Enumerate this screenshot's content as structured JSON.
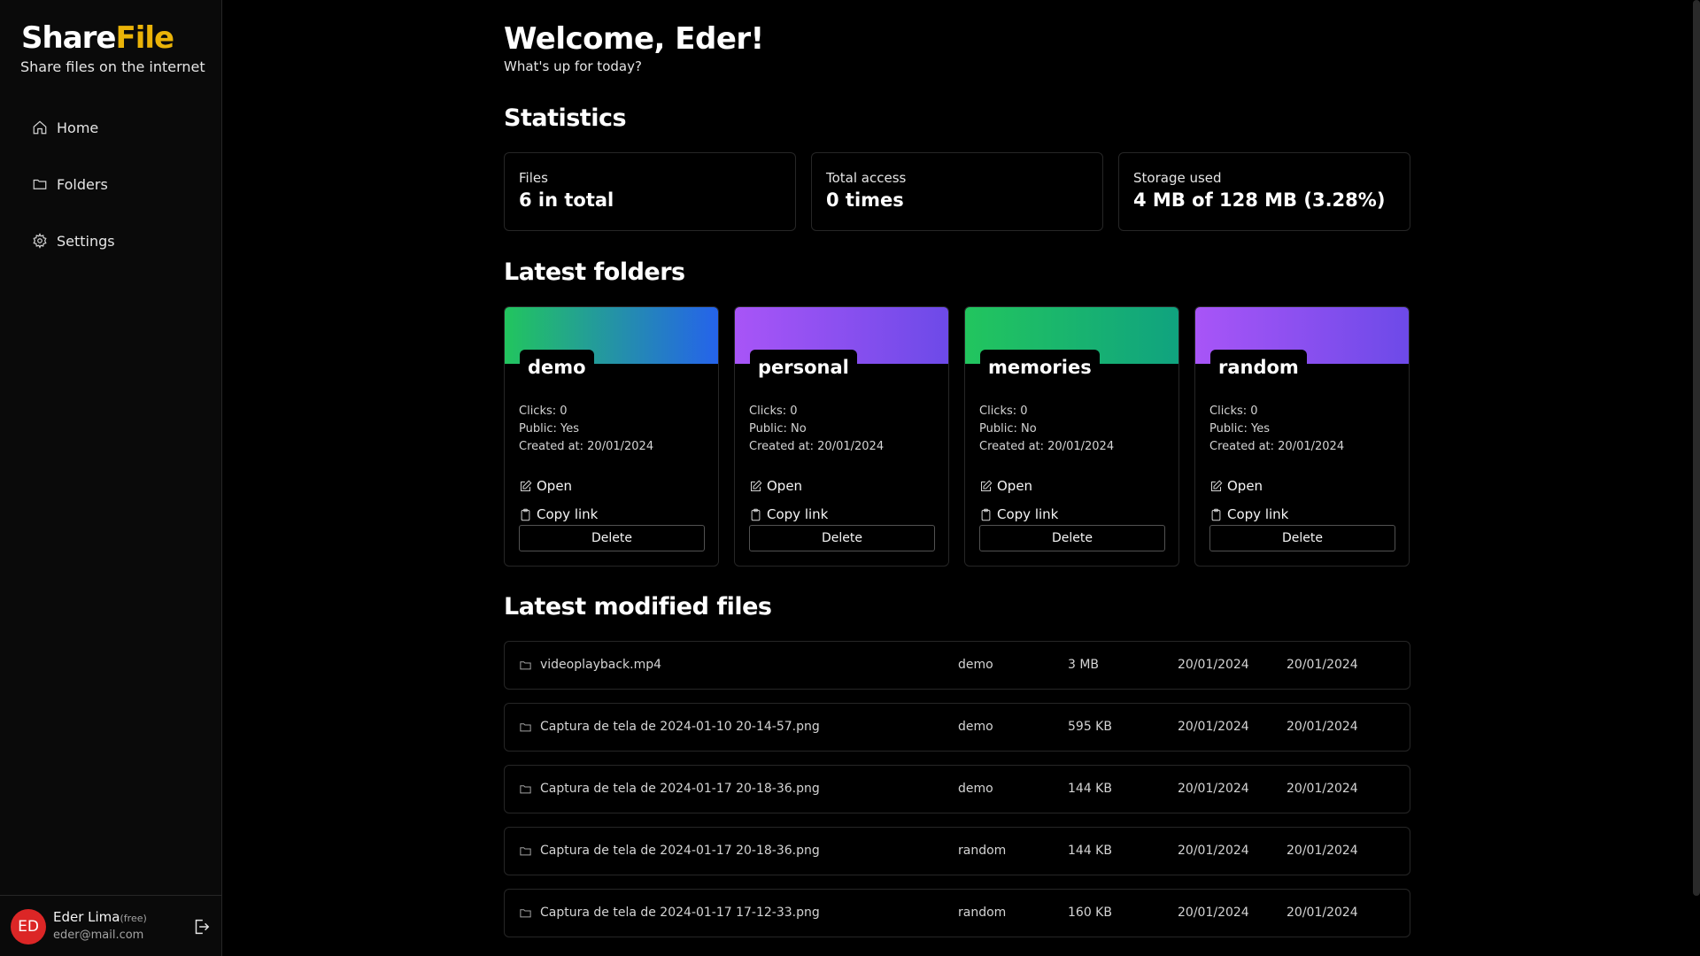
{
  "brand": {
    "name_main": "Share",
    "name_accent": "File",
    "tagline": "Share files on the internet",
    "accent_color": "#eab308"
  },
  "nav": [
    {
      "label": "Home",
      "icon": "home-icon"
    },
    {
      "label": "Folders",
      "icon": "folder-icon"
    },
    {
      "label": "Settings",
      "icon": "gear-icon"
    }
  ],
  "user": {
    "initials": "ED",
    "name": "Eder Lima",
    "plan": "(free)",
    "email": "eder@mail.com",
    "avatar_color": "#dc2626"
  },
  "header": {
    "title": "Welcome, Eder!",
    "subtitle": "What's up for today?"
  },
  "statistics": {
    "title": "Statistics",
    "cards": [
      {
        "label": "Files",
        "value": "6 in total"
      },
      {
        "label": "Total access",
        "value": "0 times"
      },
      {
        "label": "Storage used",
        "value": "4 MB of 128 MB (3.28%)"
      }
    ]
  },
  "latest_folders": {
    "title": "Latest folders",
    "items": [
      {
        "name": "demo",
        "clicks": "Clicks: 0",
        "public": "Public: Yes",
        "created": "Created at: 20/01/2024",
        "open": "Open",
        "copy": "Copy link",
        "delete": "Delete",
        "gradient": [
          "#22c55e",
          "#2563eb"
        ]
      },
      {
        "name": "personal",
        "clicks": "Clicks: 0",
        "public": "Public: No",
        "created": "Created at: 20/01/2024",
        "open": "Open",
        "copy": "Copy link",
        "delete": "Delete",
        "gradient": [
          "#a855f7",
          "#6d4ae8"
        ]
      },
      {
        "name": "memories",
        "clicks": "Clicks: 0",
        "public": "Public: No",
        "created": "Created at: 20/01/2024",
        "open": "Open",
        "copy": "Copy link",
        "delete": "Delete",
        "gradient": [
          "#22c55e",
          "#10a37f"
        ]
      },
      {
        "name": "random",
        "clicks": "Clicks: 0",
        "public": "Public: Yes",
        "created": "Created at: 20/01/2024",
        "open": "Open",
        "copy": "Copy link",
        "delete": "Delete",
        "gradient": [
          "#a855f7",
          "#6d4ae8"
        ]
      }
    ]
  },
  "latest_files": {
    "title": "Latest modified files",
    "rows": [
      {
        "name": "videoplayback.mp4",
        "folder": "demo",
        "size": "3 MB",
        "created": "20/01/2024",
        "modified": "20/01/2024"
      },
      {
        "name": "Captura de tela de 2024-01-10 20-14-57.png",
        "folder": "demo",
        "size": "595 KB",
        "created": "20/01/2024",
        "modified": "20/01/2024"
      },
      {
        "name": "Captura de tela de 2024-01-17 20-18-36.png",
        "folder": "demo",
        "size": "144 KB",
        "created": "20/01/2024",
        "modified": "20/01/2024"
      },
      {
        "name": "Captura de tela de 2024-01-17 20-18-36.png",
        "folder": "random",
        "size": "144 KB",
        "created": "20/01/2024",
        "modified": "20/01/2024"
      },
      {
        "name": "Captura de tela de 2024-01-17 17-12-33.png",
        "folder": "random",
        "size": "160 KB",
        "created": "20/01/2024",
        "modified": "20/01/2024"
      }
    ]
  }
}
